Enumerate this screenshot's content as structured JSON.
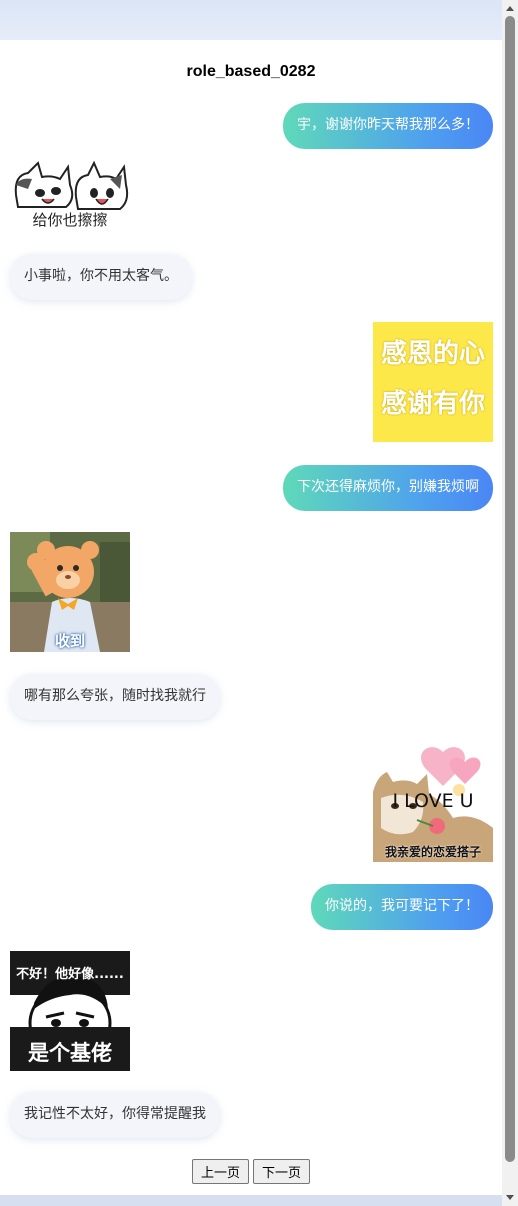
{
  "conversation": {
    "title": "role_based_0282",
    "messages": [
      {
        "from": "me",
        "type": "text",
        "text": "宇，谢谢你昨天帮我那么多！"
      },
      {
        "from": "them",
        "type": "sticker",
        "icon": "cats-wiping-sticker",
        "caption": "给你也擦擦"
      },
      {
        "from": "them",
        "type": "text",
        "text": "小事啦，你不用太客气。"
      },
      {
        "from": "me",
        "type": "sticker",
        "icon": "gratitude-text-sticker",
        "lines": [
          "感恩的心",
          "感谢有你"
        ],
        "bg_color": "#fde84a"
      },
      {
        "from": "me",
        "type": "text",
        "text": "下次还得麻烦你，别嫌我烦啊"
      },
      {
        "from": "them",
        "type": "sticker",
        "icon": "bear-mascot-sticker",
        "caption": "收到"
      },
      {
        "from": "them",
        "type": "text",
        "text": "哪有那么夸张，随时找我就行"
      },
      {
        "from": "me",
        "type": "sticker",
        "icon": "love-cat-sticker",
        "top_text": "I LOVE U",
        "caption": "我亲爱的恋爱搭子"
      },
      {
        "from": "me",
        "type": "text",
        "text": "你说的，我可要记下了！"
      },
      {
        "from": "them",
        "type": "sticker",
        "icon": "cartoon-face-sticker",
        "top_text": "不好！他好像......",
        "caption": "是个基佬"
      },
      {
        "from": "them",
        "type": "text",
        "text": "我记性不太好，你得常提醒我"
      }
    ]
  },
  "pagination": {
    "prev_label": "上一页",
    "next_label": "下一页"
  },
  "theme": {
    "me_gradient_start": "#5fd9b9",
    "me_gradient_end": "#4a86f4",
    "them_bubble": "#f3f5fa"
  }
}
